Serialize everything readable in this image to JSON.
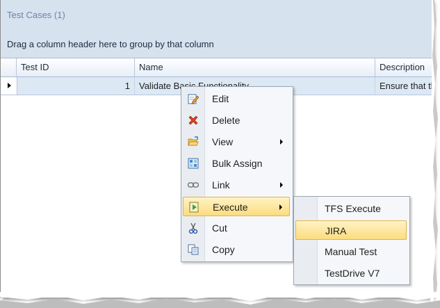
{
  "panel": {
    "title": "Test Cases (1)",
    "group_hint": "Drag a column header here to group by that column"
  },
  "columns": [
    {
      "label": "Test ID"
    },
    {
      "label": "Name"
    },
    {
      "label": "Description"
    }
  ],
  "rows": [
    {
      "test_id": "1",
      "name": "Validate Basic Functionality",
      "description": "Ensure that th"
    }
  ],
  "context_menu": {
    "items": [
      {
        "label": "Edit",
        "icon": "edit-icon"
      },
      {
        "label": "Delete",
        "icon": "delete-icon"
      },
      {
        "label": "View",
        "icon": "folder-open-icon",
        "has_submenu": true
      },
      {
        "label": "Bulk Assign",
        "icon": "bulk-assign-icon"
      },
      {
        "label": "Link",
        "icon": "chain-link-icon",
        "has_submenu": true
      },
      {
        "label": "Execute",
        "icon": "execute-icon",
        "has_submenu": true,
        "highlighted": true
      },
      {
        "label": "Cut",
        "icon": "scissors-icon"
      },
      {
        "label": "Copy",
        "icon": "copy-icon"
      }
    ]
  },
  "execute_submenu": {
    "items": [
      {
        "label": "TFS Execute"
      },
      {
        "label": "JIRA",
        "highlighted": true
      },
      {
        "label": "Manual Test"
      },
      {
        "label": "TestDrive V7"
      }
    ]
  }
}
